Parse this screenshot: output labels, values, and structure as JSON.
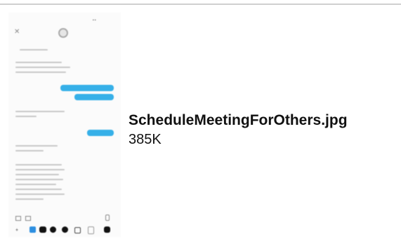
{
  "file": {
    "name": "ScheduleMeetingForOthers.jpg",
    "size": "385K"
  }
}
